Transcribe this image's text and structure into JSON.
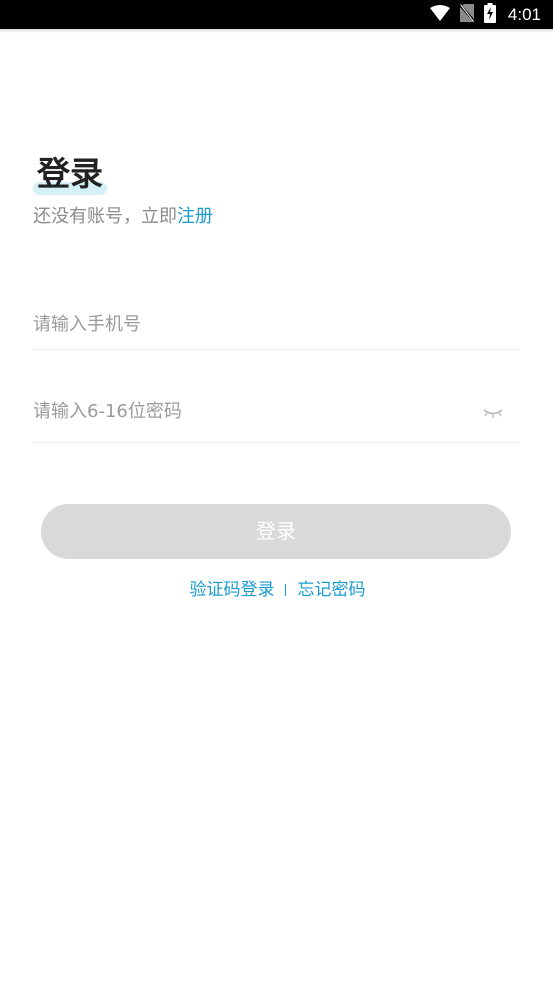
{
  "status_bar": {
    "time": "4:01",
    "icons": [
      "wifi-icon",
      "no-sim-icon",
      "battery-charging-icon"
    ]
  },
  "title": "登录",
  "subtitle": {
    "prompt": "还没有账号，立即",
    "register_link": "注册"
  },
  "phone_input": {
    "value": "",
    "placeholder": "请输入手机号"
  },
  "password_input": {
    "value": "",
    "placeholder": "请输入6-16位密码",
    "visibility_icon": "eye-closed-icon"
  },
  "login_button": {
    "label": "登录",
    "enabled": false
  },
  "links": {
    "sms_login": "验证码登录",
    "forgot_password": "忘记密码"
  },
  "colors": {
    "accent": "#1a9bd0",
    "title_highlight": "#d3f1f6",
    "button_disabled": "#d9d9d9",
    "placeholder": "#9a9a9a",
    "title_text": "#222222"
  }
}
